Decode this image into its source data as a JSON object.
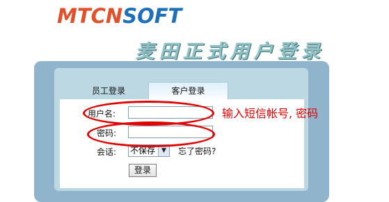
{
  "header": {
    "logo_part_a": "MTCN",
    "logo_part_b": "SOFT",
    "subtitle": "麦田正式用户登录"
  },
  "tabs": [
    {
      "label": "员工登录",
      "active": false
    },
    {
      "label": "客户登录",
      "active": true
    }
  ],
  "form": {
    "username_label": "用户名:",
    "username_value": "",
    "password_label": "密码:",
    "password_value": "",
    "session_label": "会话:",
    "session_selected": "不保存",
    "forgot_link": "忘了密码?",
    "login_button": "登录"
  },
  "annotation": {
    "text": "输入短信帐号, 密码",
    "color": "#e00000"
  },
  "colors": {
    "logo_red": "#e0502a",
    "logo_blue": "#1c6fb8",
    "outer_panel": "#8fb4cc",
    "inner_panel": "#bcd8e3"
  }
}
